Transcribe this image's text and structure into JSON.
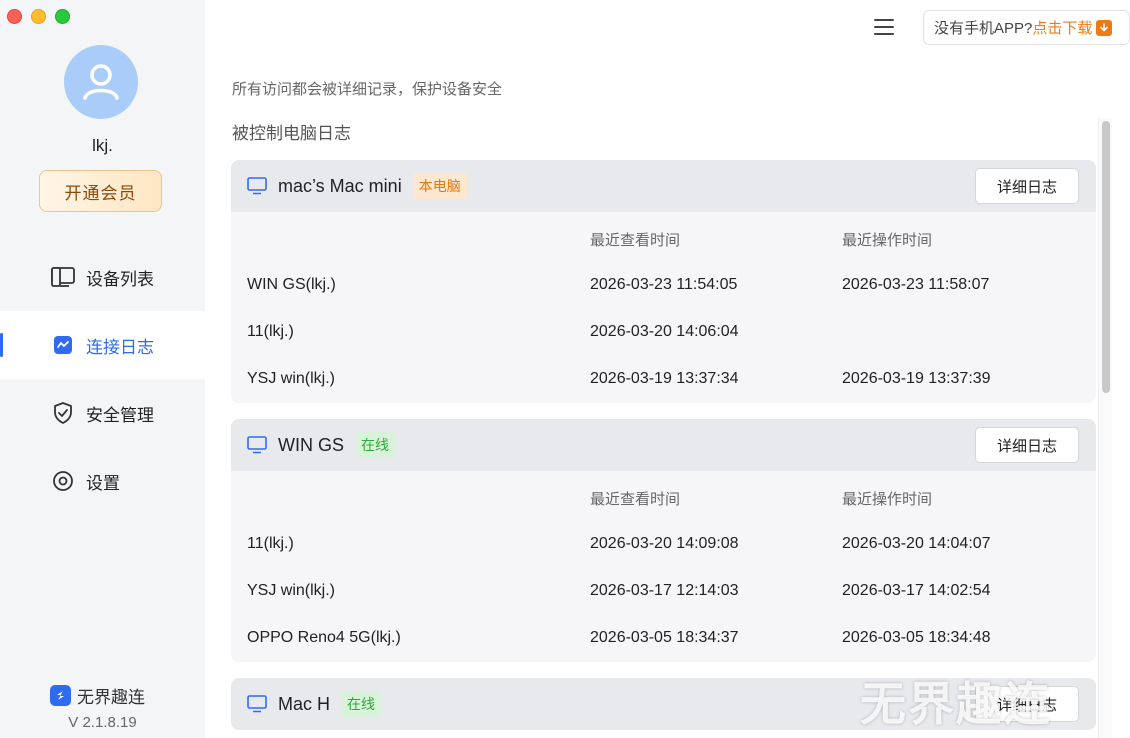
{
  "window": {
    "controls": [
      "close",
      "minimize",
      "maximize"
    ]
  },
  "sidebar": {
    "username": "lkj.",
    "vip_button": "开通会员",
    "nav": [
      {
        "label": "设备列表",
        "icon": "device-list-icon",
        "active": false
      },
      {
        "label": "连接日志",
        "icon": "connection-log-icon",
        "active": true
      },
      {
        "label": "安全管理",
        "icon": "shield-icon",
        "active": false
      },
      {
        "label": "设置",
        "icon": "settings-icon",
        "active": false
      }
    ],
    "brand_name": "无界趣连",
    "version": "V 2.1.8.19"
  },
  "header": {
    "app_prompt": "没有手机APP?",
    "app_link": "点击下载"
  },
  "notice": "所有访问都会被详细记录，保护设备安全",
  "section_title": "被控制电脑日志",
  "columns": {
    "last_view": "最近查看时间",
    "last_op": "最近操作时间"
  },
  "detail_button": "详细日志",
  "devices": [
    {
      "name": "mac’s Mac mini",
      "badge": "本电脑",
      "badge_color": "orange",
      "detail": "详细日志",
      "rows": [
        {
          "visitor": "WIN GS(lkj.)",
          "last_view": "2026-03-23 11:54:05",
          "last_op": "2026-03-23 11:58:07"
        },
        {
          "visitor": "11(lkj.)",
          "last_view": "2026-03-20 14:06:04",
          "last_op": ""
        },
        {
          "visitor": "YSJ win(lkj.)",
          "last_view": "2026-03-19 13:37:34",
          "last_op": "2026-03-19 13:37:39"
        }
      ]
    },
    {
      "name": "WIN GS",
      "badge": "在线",
      "badge_color": "green",
      "detail": "详细日志",
      "rows": [
        {
          "visitor": "11(lkj.)",
          "last_view": "2026-03-20 14:09:08",
          "last_op": "2026-03-20 14:04:07"
        },
        {
          "visitor": "YSJ win(lkj.)",
          "last_view": "2026-03-17 12:14:03",
          "last_op": "2026-03-17 14:02:54"
        },
        {
          "visitor": "OPPO Reno4 5G(lkj.)",
          "last_view": "2026-03-05 18:34:37",
          "last_op": "2026-03-05 18:34:48"
        }
      ]
    },
    {
      "name": "Mac H",
      "badge": "在线",
      "badge_color": "green",
      "detail": "详细日志",
      "rows": []
    }
  ],
  "watermark": "无界趣连",
  "colors": {
    "accent": "#2f6bf0",
    "orange": "#f07a12",
    "green": "#2fa83a"
  }
}
